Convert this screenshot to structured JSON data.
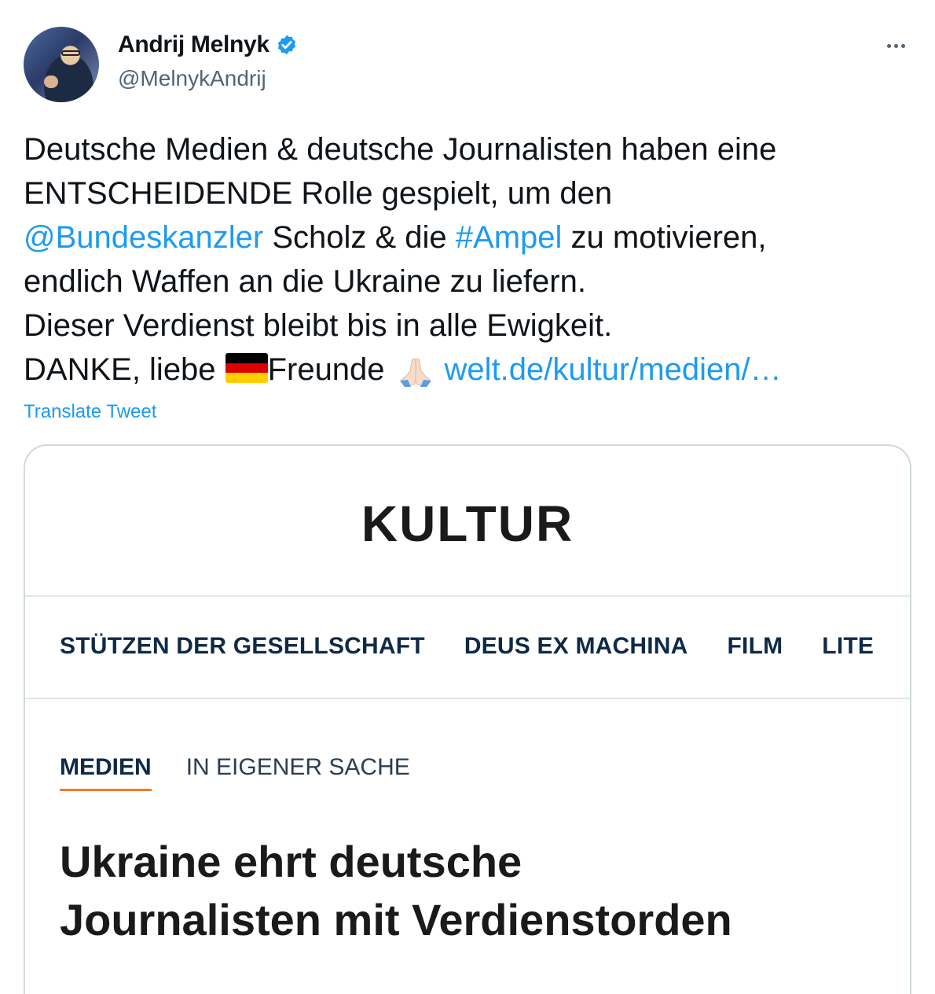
{
  "author": {
    "display_name": "Andrij Melnyk",
    "handle": "@MelnykAndrij"
  },
  "tweet": {
    "line1": "Deutsche Medien & deutsche Journalisten haben eine",
    "line2": "ENTSCHEIDENDE Rolle gespielt, um den",
    "mention": "@Bundeskanzler",
    "line3_mid": " Scholz & die ",
    "hashtag": "#Ampel",
    "line3_end": " zu motivieren,",
    "line4": "endlich Waffen an die Ukraine zu liefern.",
    "line5": "Dieser Verdienst bleibt bis in alle Ewigkeit.",
    "line6_start": "DANKE, liebe",
    "line6_mid": "Freunde",
    "link": "welt.de/kultur/medien/…",
    "translate": "Translate Tweet"
  },
  "card": {
    "section": "KULTUR",
    "nav": [
      "STÜTZEN DER GESELLSCHAFT",
      "DEUS EX MACHINA",
      "FILM",
      "LITE"
    ],
    "tabs": [
      "MEDIEN",
      "IN EIGENER SACHE"
    ],
    "headline_line1": "Ukraine ehrt deutsche",
    "headline_line2": "Journalisten mit Verdienstorden"
  },
  "icons": {
    "verified": "verified-badge-icon",
    "more": "more-options-icon",
    "flag": "germany-flag-emoji",
    "pray": "folded-hands-emoji"
  },
  "colors": {
    "link": "#1d9bf0",
    "secondary_text": "#536471",
    "tab_underline": "#ee7d2b",
    "nav_text": "#0e2a47"
  }
}
